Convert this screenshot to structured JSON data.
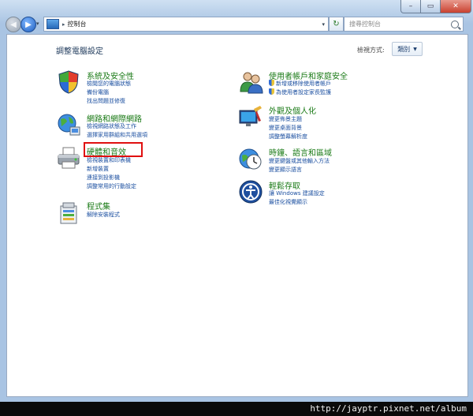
{
  "window": {
    "min_glyph": "–",
    "max_glyph": "▭",
    "close_glyph": "✕"
  },
  "nav": {
    "back_glyph": "◀",
    "forward_glyph": "▶",
    "dropdown_glyph": "▾",
    "address_separator": "▸",
    "address_text": "控制台",
    "address_dropdown_glyph": "▾",
    "refresh_glyph": "↻",
    "search_placeholder": "搜尋控制台"
  },
  "header": {
    "title": "調整電腦設定",
    "view_label": "檢視方式:",
    "view_value": "類別",
    "view_arrow": "▼"
  },
  "categories": {
    "system": {
      "title": "系統及安全性",
      "links": [
        "檢閱您的電腦狀態",
        "備份電腦",
        "找出問題並修復"
      ]
    },
    "network": {
      "title": "網路和網際網路",
      "links": [
        "檢視網路狀態及工作",
        "選擇家用群組和共用選項"
      ]
    },
    "hardware": {
      "title": "硬體和音效",
      "links": [
        "檢視裝置和印表機",
        "新增裝置",
        "連接到投影機",
        "調整常用的行動設定"
      ]
    },
    "programs": {
      "title": "程式集",
      "links": [
        "解除安裝程式"
      ]
    },
    "users": {
      "title": "使用者帳戶和家庭安全",
      "links": [
        "新增或移除使用者帳戶",
        "為使用者設定家長監護"
      ]
    },
    "appearance": {
      "title": "外觀及個人化",
      "links": [
        "變更佈景主題",
        "變更桌面背景",
        "調整螢幕解析度"
      ]
    },
    "clock": {
      "title": "時鐘、語言和區域",
      "links": [
        "變更鍵盤或其他輸入方法",
        "變更顯示語言"
      ]
    },
    "ease": {
      "title": "輕鬆存取",
      "links": [
        "讓 Windows 建議設定",
        "最佳化視覺顯示"
      ]
    }
  },
  "colors": {
    "category_title": "#1a7a16",
    "link": "#1b4fa0",
    "highlight": "#e01010"
  },
  "watermark": "http://jayptr.pixnet.net/album"
}
